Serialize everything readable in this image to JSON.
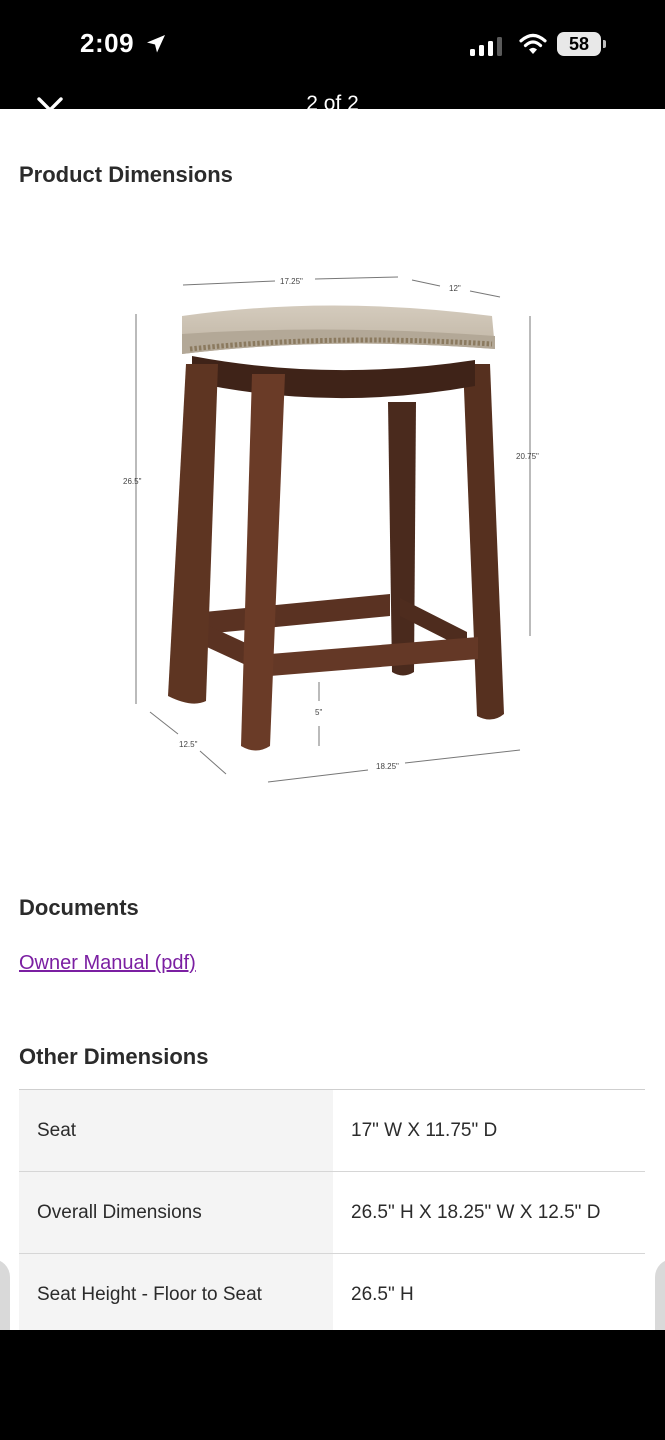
{
  "status_bar": {
    "time": "2:09",
    "battery": "58"
  },
  "nav": {
    "pager": "2 of 2"
  },
  "product_dimensions": {
    "heading": "Product Dimensions",
    "image_labels": {
      "top_width": "17.25\"",
      "top_depth": "12\"",
      "seat_height": "20.75\"",
      "overall_height": "26.5\"",
      "bottom_depth": "12.5\"",
      "bottom_width": "18.25\"",
      "stretcher_height": "5\""
    }
  },
  "documents": {
    "heading": "Documents",
    "link": "Owner Manual (pdf)"
  },
  "other_dimensions": {
    "heading": "Other Dimensions",
    "rows": [
      {
        "label": "Seat",
        "value": "17\" W X 11.75\" D"
      },
      {
        "label": "Overall Dimensions",
        "value": "26.5\" H X 18.25\" W X 12.5\" D"
      },
      {
        "label": "Seat Height - Floor to Seat",
        "value": "26.5\" H"
      }
    ]
  }
}
